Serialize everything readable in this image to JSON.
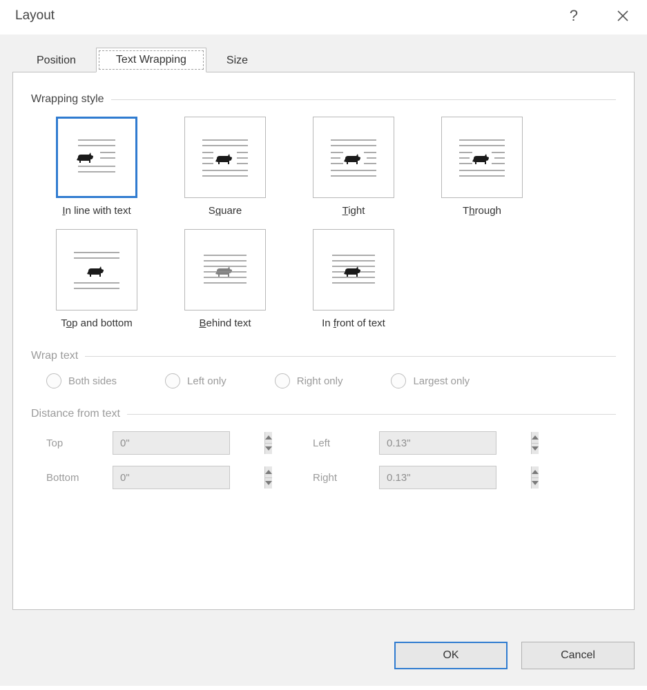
{
  "title": "Layout",
  "tabs": {
    "position": "Position",
    "text_wrapping": "Text Wrapping",
    "size": "Size"
  },
  "group_wrapping_style": "Wrapping style",
  "styles": {
    "inline": "In line with text",
    "square": "Square",
    "tight": "Tight",
    "through": "Through",
    "topbot": "Top and bottom",
    "behind": "Behind text",
    "front": "In front of text"
  },
  "group_wrap_text": "Wrap text",
  "radios": {
    "both": "Both sides",
    "left": "Left only",
    "right": "Right only",
    "largest": "Largest only"
  },
  "group_distance": "Distance from text",
  "distance": {
    "top_label": "Top",
    "bottom_label": "Bottom",
    "left_label": "Left",
    "right_label": "Right",
    "top": "0\"",
    "bottom": "0\"",
    "left": "0.13\"",
    "right": "0.13\""
  },
  "buttons": {
    "ok": "OK",
    "cancel": "Cancel"
  }
}
